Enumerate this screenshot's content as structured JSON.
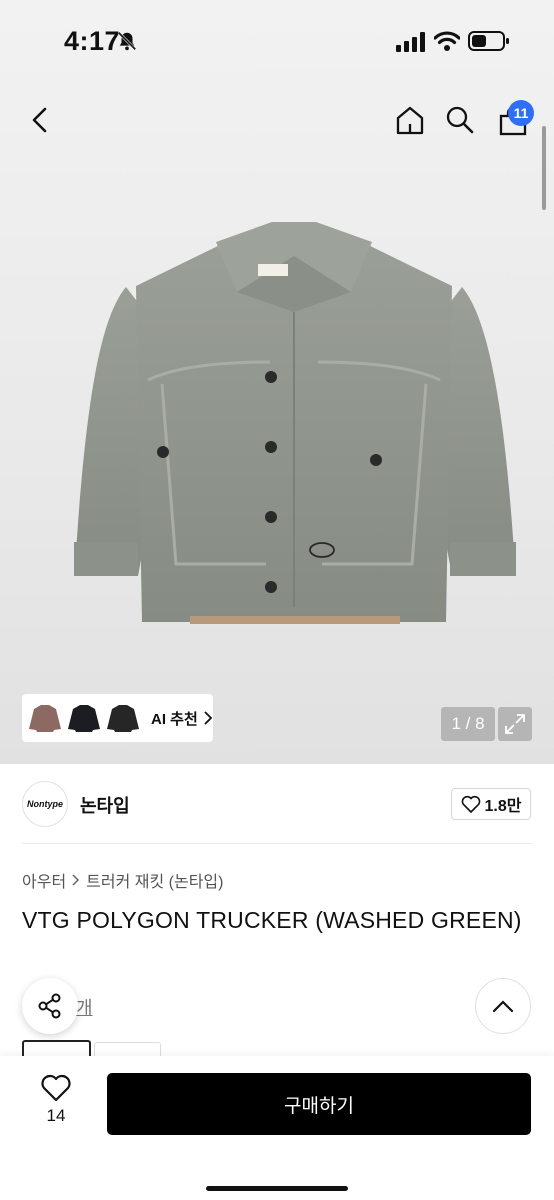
{
  "status_bar": {
    "time": "4:17"
  },
  "nav": {
    "cart_count": "11"
  },
  "gallery": {
    "counter": "1 / 8"
  },
  "ai_recommend": {
    "label": "AI 추천"
  },
  "brand": {
    "logo_text": "Nontype",
    "name": "논타입",
    "likes": "1.8만"
  },
  "breadcrumb": {
    "category": "아우터",
    "subcategory": "트러커 재킷 (논타입)"
  },
  "product": {
    "title": "VTG POLYGON TRUCKER (WASHED GREEN)"
  },
  "reviews": {
    "link_text": "개"
  },
  "bottom_bar": {
    "wish_count": "14",
    "buy_label": "구매하기"
  },
  "colors": {
    "accent_badge": "#2f6ff5",
    "buy_button": "#000000",
    "jacket": "#8e938b"
  },
  "icons": [
    "bell-slash-icon",
    "signal-icon",
    "wifi-icon",
    "battery-icon",
    "back-icon",
    "home-icon",
    "search-icon",
    "cart-icon",
    "expand-icon",
    "heart-icon",
    "share-icon",
    "chevron-up-icon"
  ]
}
